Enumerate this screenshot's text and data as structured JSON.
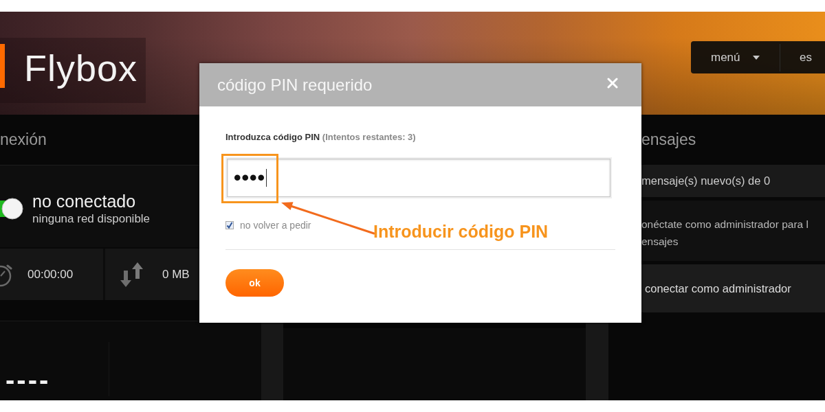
{
  "header": {
    "logo": "Flybox",
    "nav": [
      {
        "kind": "dropdown",
        "label": "menú"
      },
      {
        "kind": "plain",
        "label": "es"
      }
    ]
  },
  "connection": {
    "title": "nexión",
    "toggle": {
      "on": true
    },
    "status": "no conectado",
    "detail": "ninguna red disponible",
    "stats": [
      {
        "kind": "timer",
        "value": "00:00:00"
      },
      {
        "kind": "transfer",
        "value": "0 MB"
      }
    ],
    "signal": "----"
  },
  "messages": {
    "title": "ensajes",
    "rows": [
      {
        "kind": "count",
        "text": "mensaje(s) nuevo(s) de 0"
      },
      {
        "kind": "note",
        "lines": [
          "onéctate como administrador para l",
          "ensajes"
        ]
      },
      {
        "kind": "link",
        "text": "conectar como administrador"
      }
    ]
  },
  "dialog": {
    "title": "código PIN requerido",
    "label": "Introduzca código PIN",
    "hint": "(Intentos restantes: 3)",
    "pin": {
      "value": "••••"
    },
    "remember": {
      "label": "no volver a pedir",
      "checked": true
    },
    "buttons": [
      "ok"
    ]
  },
  "annotation": {
    "text": "Introducir código PIN"
  }
}
